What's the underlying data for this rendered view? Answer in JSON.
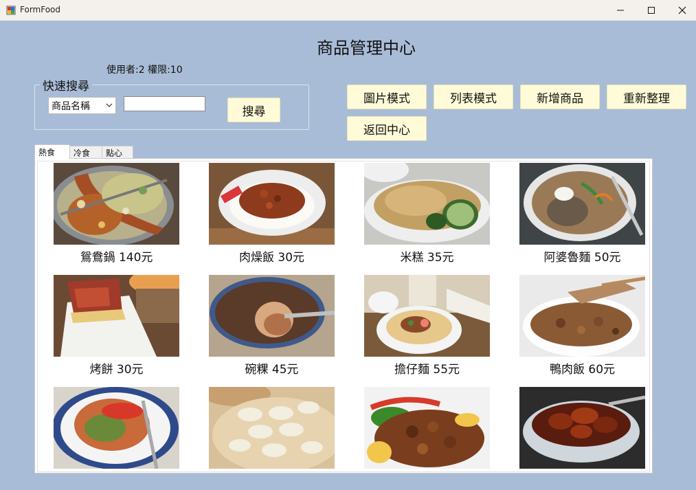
{
  "window": {
    "title": "FormFood"
  },
  "header": {
    "title": "商品管理中心",
    "user_info": "使用者:2 權限:10"
  },
  "search": {
    "legend": "快速搜尋",
    "field_selected": "商品名稱",
    "input_value": "",
    "button_label": "搜尋"
  },
  "toolbar": {
    "picture_mode": "圖片模式",
    "list_mode": "列表模式",
    "add_product": "新增商品",
    "refresh": "重新整理",
    "back": "返回中心"
  },
  "tabs": [
    {
      "label": "熱食",
      "selected": true
    },
    {
      "label": "冷食",
      "selected": false
    },
    {
      "label": "點心",
      "selected": false
    }
  ],
  "products": [
    {
      "label": "鴛鴦鍋 140元"
    },
    {
      "label": "肉燥飯 30元"
    },
    {
      "label": "米糕 35元"
    },
    {
      "label": "阿婆魯麵 50元"
    },
    {
      "label": "烤餅 30元"
    },
    {
      "label": "碗粿 45元"
    },
    {
      "label": "擔仔麵 55元"
    },
    {
      "label": "鴨肉飯 60元"
    },
    {
      "label": ""
    },
    {
      "label": ""
    },
    {
      "label": ""
    },
    {
      "label": ""
    }
  ]
}
